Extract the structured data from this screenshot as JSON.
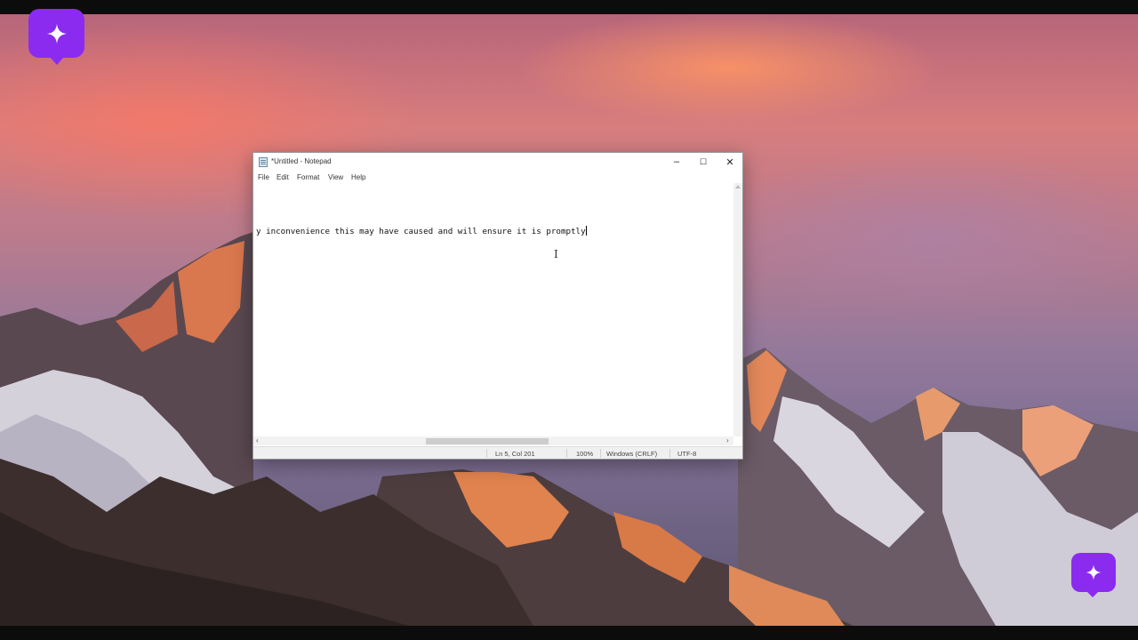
{
  "brand": {
    "accent": "#8b2bf0",
    "logo_icon": "sparkle-icon"
  },
  "window": {
    "title": "*Untitled - Notepad",
    "controls": {
      "minimize": "–",
      "maximize": "☐",
      "close": "✕"
    }
  },
  "menu": [
    "File",
    "Edit",
    "Format",
    "View",
    "Help"
  ],
  "editor": {
    "text": "y inconvenience this may have caused and will ensure it is promptly"
  },
  "status": {
    "position": "Ln 5, Col 201",
    "zoom": "100%",
    "line_ending": "Windows (CRLF)",
    "encoding": "UTF-8"
  }
}
